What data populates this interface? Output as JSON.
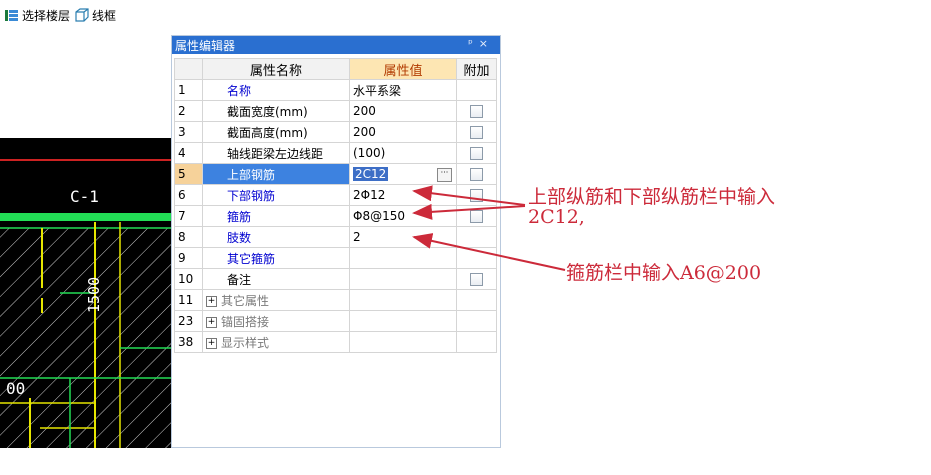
{
  "toolbar": {
    "select_floor_label": "选择楼层",
    "wireframe_label": "线框"
  },
  "panel": {
    "title": "属性编辑器",
    "pin_icon": "pin-icon",
    "close_icon": "close-icon",
    "headers": {
      "num": "",
      "name": "属性名称",
      "value": "属性值",
      "extra": "附加"
    },
    "rows": [
      {
        "num": "1",
        "name": "名称",
        "value": "水平系梁",
        "checkbox": false
      },
      {
        "num": "2",
        "name": "截面宽度(mm)",
        "value": "200",
        "checkbox": true
      },
      {
        "num": "3",
        "name": "截面高度(mm)",
        "value": "200",
        "checkbox": true
      },
      {
        "num": "4",
        "name": "轴线距梁左边线距",
        "value": "(100)",
        "checkbox": true
      },
      {
        "num": "5",
        "name": "上部钢筋",
        "value": "2C12",
        "checkbox": true
      },
      {
        "num": "6",
        "name": "下部钢筋",
        "value": "2Φ12",
        "checkbox": true
      },
      {
        "num": "7",
        "name": "箍筋",
        "value": "Φ8@150",
        "checkbox": true
      },
      {
        "num": "8",
        "name": "肢数",
        "value": "2",
        "checkbox": false
      },
      {
        "num": "9",
        "name": "其它箍筋",
        "value": "",
        "checkbox": false
      },
      {
        "num": "10",
        "name": "备注",
        "value": "",
        "checkbox": true
      },
      {
        "num": "11",
        "name": "其它属性",
        "value": "",
        "checkbox": false
      },
      {
        "num": "23",
        "name": "锚固搭接",
        "value": "",
        "checkbox": false
      },
      {
        "num": "38",
        "name": "显示样式",
        "value": "",
        "checkbox": false
      }
    ]
  },
  "cad": {
    "label_c1": "C-1",
    "label_1500": "1500",
    "label_00": "00"
  },
  "annotations": {
    "line1": "上部纵筋和下部纵筋栏中输入",
    "line2": "2C12,",
    "line3": "箍筋栏中输入A6@200"
  },
  "colors": {
    "annotation": "#cc2a3a",
    "selection": "#3d82e0",
    "header_value_bg": "#fde6b3"
  }
}
